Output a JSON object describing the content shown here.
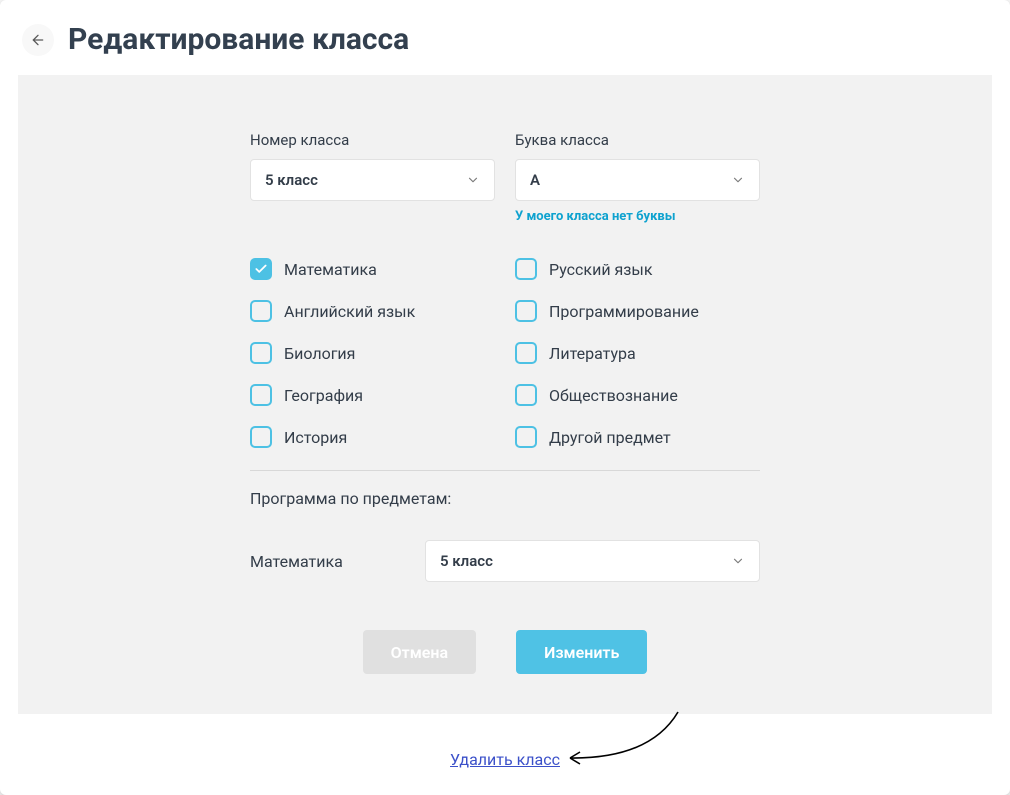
{
  "header": {
    "title": "Редактирование класса"
  },
  "form": {
    "class_number": {
      "label": "Номер класса",
      "value": "5 класс"
    },
    "class_letter": {
      "label": "Буква класса",
      "value": "А",
      "no_letter_link": "У моего класса нет буквы"
    },
    "subjects": [
      {
        "id": "math",
        "label": "Математика",
        "checked": true
      },
      {
        "id": "russian",
        "label": "Русский язык",
        "checked": false
      },
      {
        "id": "english",
        "label": "Английский язык",
        "checked": false
      },
      {
        "id": "programming",
        "label": "Программирование",
        "checked": false
      },
      {
        "id": "biology",
        "label": "Биология",
        "checked": false
      },
      {
        "id": "literature",
        "label": "Литература",
        "checked": false
      },
      {
        "id": "geography",
        "label": "География",
        "checked": false
      },
      {
        "id": "social",
        "label": "Обществознание",
        "checked": false
      },
      {
        "id": "history",
        "label": "История",
        "checked": false
      },
      {
        "id": "other",
        "label": "Другой предмет",
        "checked": false
      }
    ],
    "program_section_title": "Программа по предметам:",
    "program_rows": [
      {
        "subject": "Математика",
        "value": "5 класс"
      }
    ],
    "actions": {
      "cancel": "Отмена",
      "submit": "Изменить"
    },
    "delete_link": "Удалить класс"
  }
}
